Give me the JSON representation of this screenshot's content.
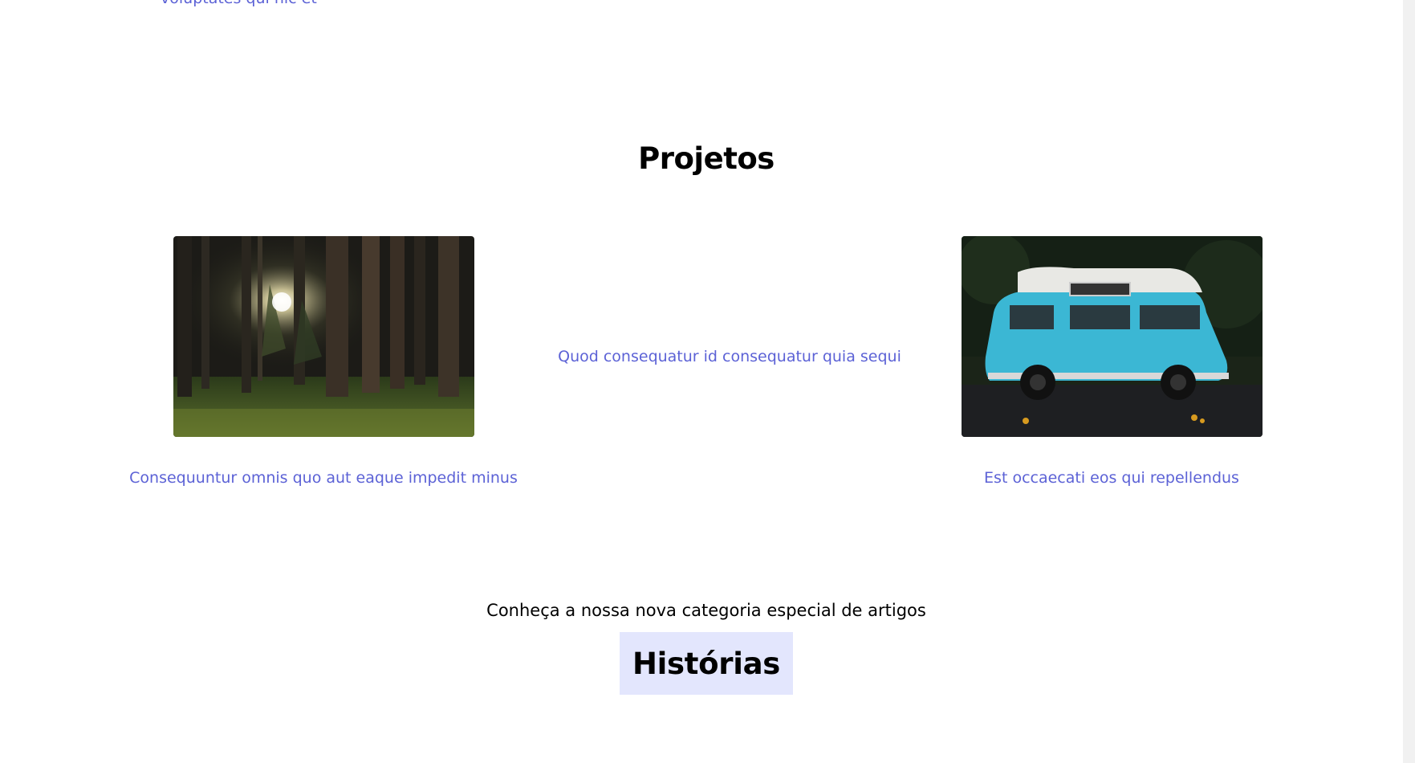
{
  "top_link": "voluptates qui nic et",
  "projects": {
    "title": "Projetos",
    "items": [
      {
        "caption": "Consequuntur omnis quo aut eaque impedit minus",
        "image": "forest-photo"
      },
      {
        "caption": "Quod consequatur id consequatur quia sequi",
        "image": null
      },
      {
        "caption": "Est occaecati eos qui repellendus",
        "image": "van-photo"
      }
    ]
  },
  "special": {
    "lead": "Conheça a nossa nova categoria especial de artigos",
    "badge": "Histórias",
    "badge_bg": "#e3e6fd"
  },
  "colors": {
    "link": "#5c62d6",
    "text": "#000000",
    "background": "#ffffff"
  }
}
